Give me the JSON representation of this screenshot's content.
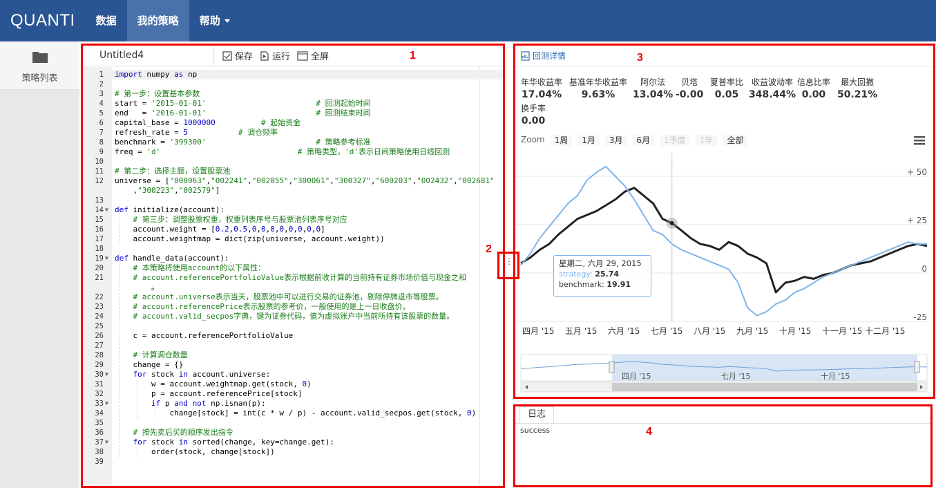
{
  "nav": {
    "brand": "QUANTI",
    "items": [
      {
        "label": "数据"
      },
      {
        "label": "我的策略"
      },
      {
        "label": "帮助"
      }
    ]
  },
  "sidebar": {
    "strategies_label": "策略列表"
  },
  "editor": {
    "file_name": "Untitled4",
    "save_label": "保存",
    "run_label": "运行",
    "fullscreen_label": "全屏",
    "lines": [
      "import numpy as np",
      "",
      "# 第一步：设置基本参数",
      "start = '2015-01-01'                        # 回测起始时间",
      "end   = '2016-01-01'                        # 回测结束时间",
      "capital_base = 1000000          # 起始资金",
      "refresh_rate = 5           # 调仓频率",
      "benchmark = '399300'                        # 策略参考标准",
      "freq = 'd'                              # 策略类型，'d'表示日间策略使用日线回测",
      "",
      "# 第二步：选择主题，设置股票池",
      "universe = [\"000063\",\"002241\",\"002055\",\"300061\",\"300327\",\"600203\",\"002432\",\"002681\"",
      "    ,\"300223\",\"002579\"]",
      "",
      "def initialize(account):",
      "    # 第三步：调整股票权重，权重列表序号与股票池列表序号对应",
      "    account.weight = [0.2,0.5,0,0,0,0,0,0,0,0]",
      "    account.weightmap = dict(zip(universe, account.weight))",
      "",
      "def handle_data(account):",
      "    # 本策略将使用account的以下属性：",
      "    # account.referencePortfolioValue表示根据前收计算的当前持有证券市场价值与现金之和",
      "        。",
      "    # account.universe表示当天，股票池中可以进行交易的证券池，剔除停牌退市等股票。",
      "    # account.referencePrice表示股票的参考价，一般使用的是上一日收盘价。",
      "    # account.valid_secpos字典，键为证券代码，值为虚拟账户中当前所持有该股票的数量。",
      "",
      "    c = account.referencePortfolioValue",
      "",
      "    # 计算调仓数量",
      "    change = {}",
      "    for stock in account.universe:",
      "        w = account.weightmap.get(stock, 0)",
      "        p = account.referencePrice[stock]",
      "        if p and not np.isnan(p):",
      "            change[stock] = int(c * w / p) - account.valid_secpos.get(stock, 0)",
      "",
      "    # 按先卖后买的顺序发出指令",
      "    for stock in sorted(change, key=change.get):",
      "        order(stock, change[stock])",
      ""
    ],
    "line_numbers": [
      "1",
      "2",
      "3",
      "4",
      "5",
      "6",
      "7",
      "8",
      "9",
      "10",
      "11",
      "12",
      "",
      "13",
      "14",
      "15",
      "16",
      "17",
      "18",
      "19",
      "20",
      "21",
      "",
      "22",
      "23",
      "24",
      "25",
      "26",
      "27",
      "28",
      "29",
      "30",
      "31",
      "32",
      "33",
      "34",
      "35",
      "36",
      "37",
      "38",
      "39"
    ]
  },
  "results": {
    "details_link": "回测详情",
    "metrics": [
      {
        "label": "年华收益率",
        "value": "17.04%"
      },
      {
        "label": "基准年华收益率",
        "value": "9.63%"
      },
      {
        "label": "阿尔法",
        "value": "13.04%"
      },
      {
        "label": "贝塔",
        "value": "-0.00"
      },
      {
        "label": "夏普率比",
        "value": "0.05"
      },
      {
        "label": "收益波动率",
        "value": "348.44%"
      },
      {
        "label": "信息比率",
        "value": "0.00"
      },
      {
        "label": "最大回撤",
        "value": "50.21%"
      },
      {
        "label": "换手率",
        "value": "0.00"
      }
    ],
    "zoom_label": "Zoom",
    "zoom_buttons": [
      {
        "label": "1周",
        "enabled": true
      },
      {
        "label": "1月",
        "enabled": true
      },
      {
        "label": "3月",
        "enabled": true
      },
      {
        "label": "6月",
        "enabled": true
      },
      {
        "label": "1季度",
        "enabled": false
      },
      {
        "label": "1年",
        "enabled": false
      },
      {
        "label": "全部",
        "enabled": true
      }
    ],
    "tooltip": {
      "date": "星期二, 六月 29, 2015",
      "strategy_label": "strategy:",
      "strategy_value": "25.74",
      "benchmark_label": "benchmark:",
      "benchmark_value": "19.91"
    },
    "navigator_labels": [
      "四月 '15",
      "七月 '15",
      "十月 '15"
    ]
  },
  "chart_data": {
    "type": "line",
    "x_labels": [
      "四月 '15",
      "五月 '15",
      "六月 '15",
      "七月 '15",
      "八月 '15",
      "九月 '15",
      "十月 '15",
      "十一月 '15",
      "十二月 '15"
    ],
    "y_ticks": [
      "+ 50",
      "+ 25",
      "0",
      "-25"
    ],
    "ylim": [
      -25,
      60
    ],
    "series": [
      {
        "name": "strategy",
        "color": "#222222",
        "values": [
          5,
          8,
          12,
          15,
          20,
          24,
          28,
          30,
          32,
          35,
          38,
          42,
          44,
          40,
          36,
          28,
          25.74,
          22,
          18,
          15,
          14,
          12,
          16,
          14,
          10,
          8,
          5,
          -10,
          -5,
          -4,
          -2,
          -3,
          -1,
          0,
          2,
          4,
          5,
          6,
          8,
          10,
          12,
          14,
          15,
          14
        ]
      },
      {
        "name": "benchmark",
        "color": "#7cb5ec",
        "values": [
          4,
          10,
          18,
          24,
          30,
          36,
          40,
          48,
          52,
          55,
          50,
          45,
          38,
          30,
          22,
          19.91,
          15,
          12,
          10,
          8,
          6,
          4,
          2,
          -5,
          -18,
          -22,
          -20,
          -16,
          -14,
          -10,
          -8,
          -5,
          -2,
          0,
          2,
          4,
          6,
          8,
          10,
          12,
          14,
          16,
          15,
          15
        ]
      }
    ],
    "tooltip_index": 16,
    "grid": true,
    "legend": "none"
  },
  "log": {
    "tab_label": "日志",
    "text": "success"
  },
  "annotations": [
    "1",
    "2",
    "3",
    "4"
  ]
}
